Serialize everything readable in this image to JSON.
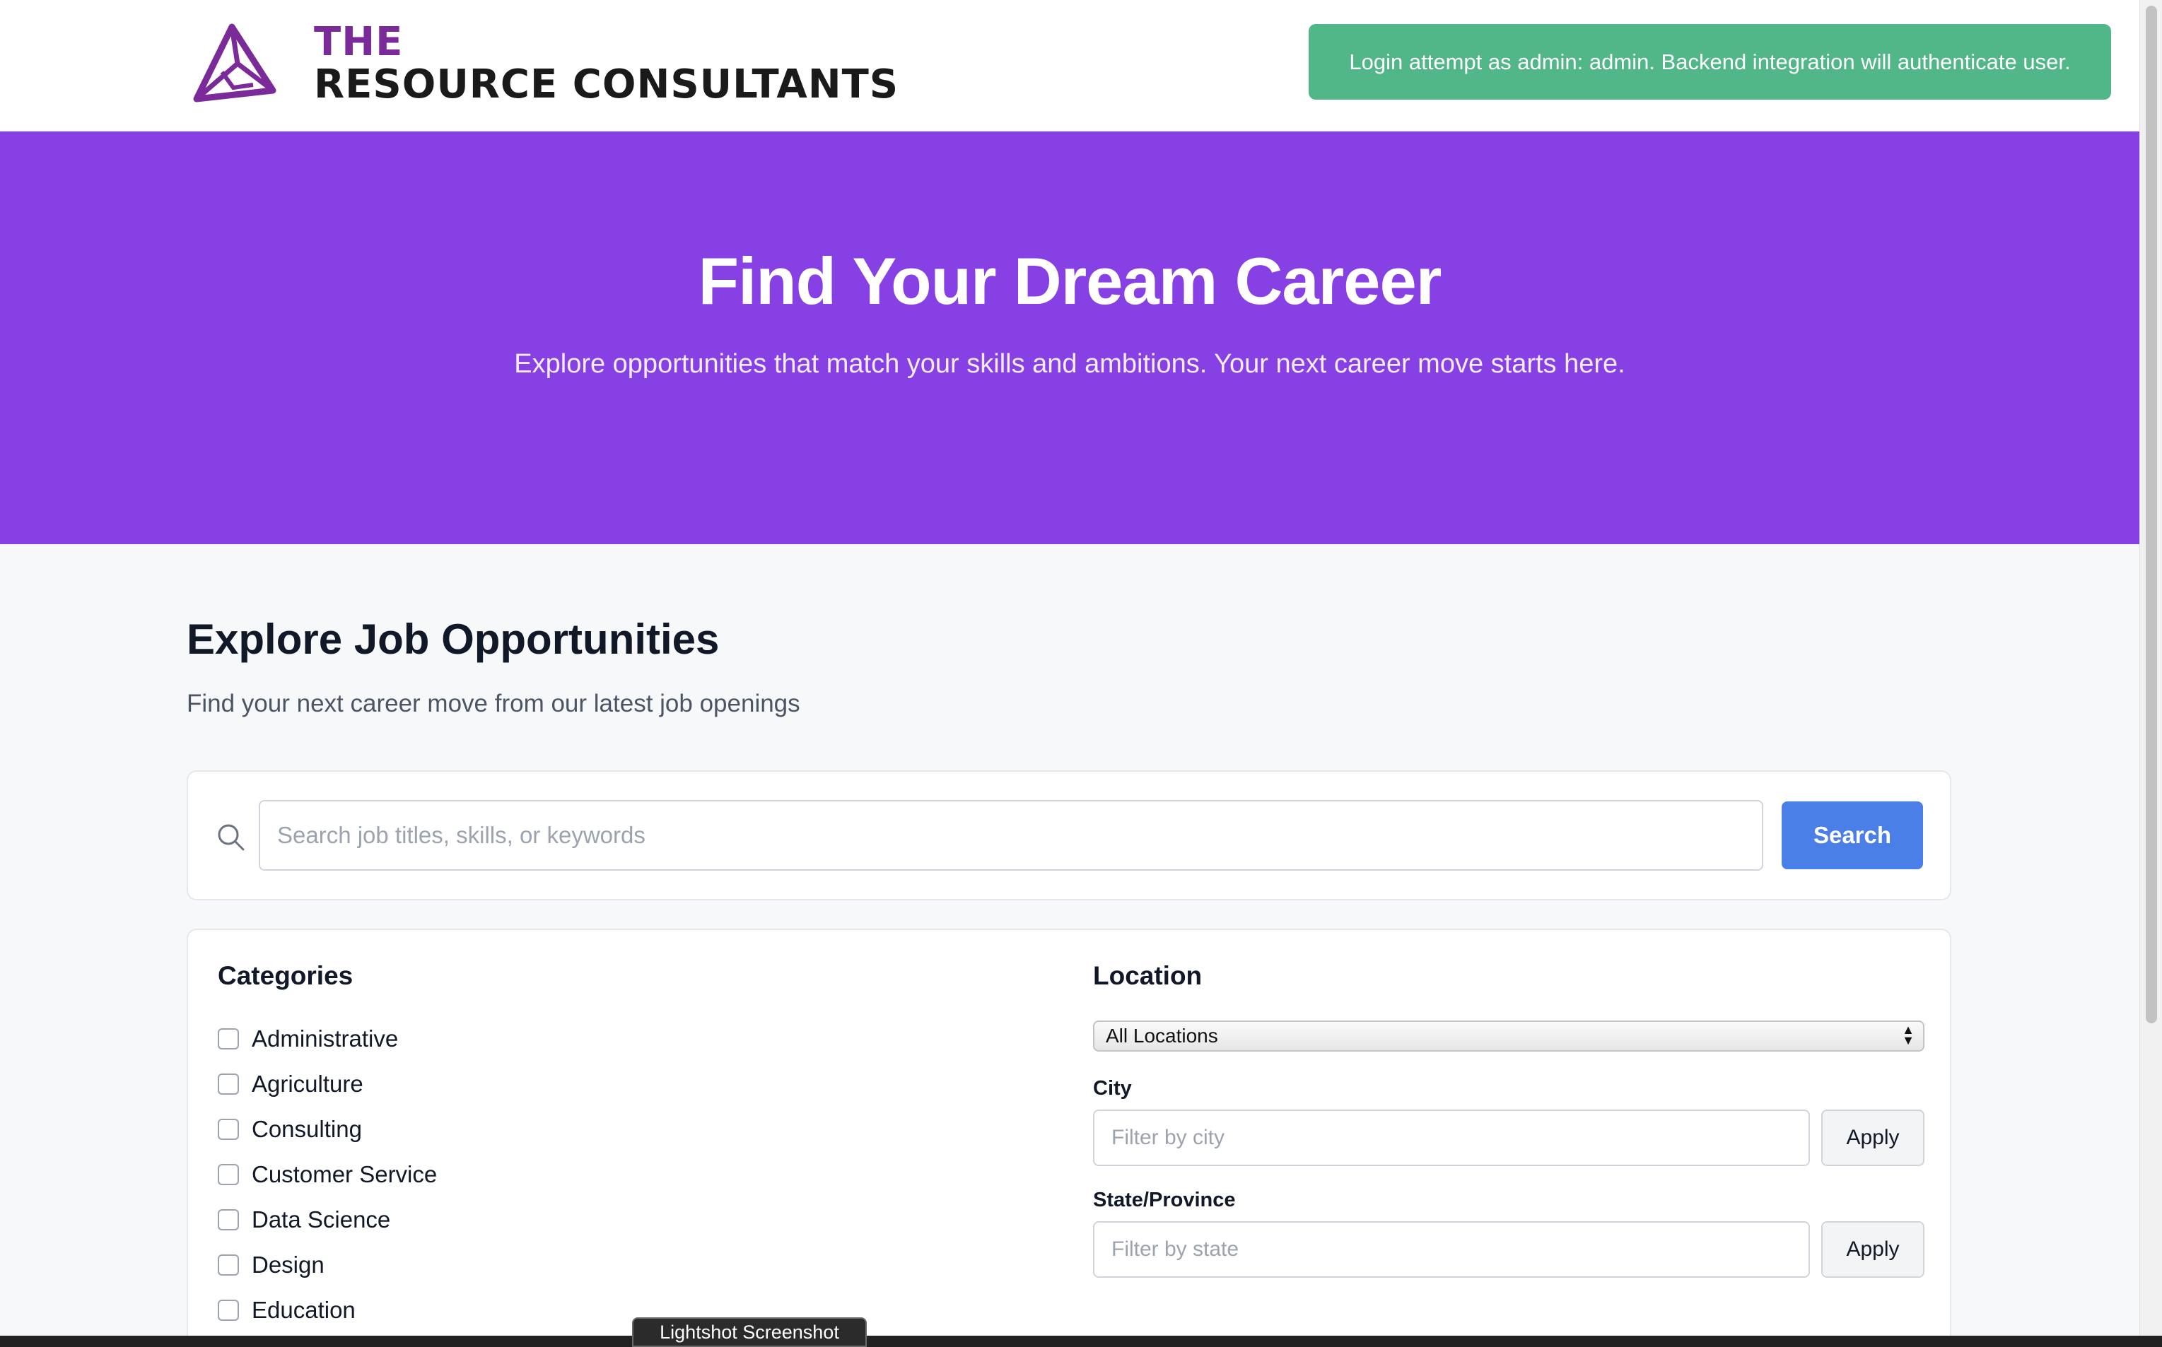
{
  "header": {
    "logo_line1": "THE",
    "logo_line2": "RESOURCE CONSULTANTS",
    "toast_message": "Login attempt as admin: admin. Backend integration will authenticate user."
  },
  "hero": {
    "title": "Find Your Dream Career",
    "subtitle": "Explore opportunities that match your skills and ambitions. Your next career move starts here."
  },
  "jobs": {
    "title": "Explore Job Opportunities",
    "subtitle": "Find your next career move from our latest job openings",
    "search": {
      "placeholder": "Search job titles, skills, or keywords",
      "button_label": "Search",
      "icon": "search-icon"
    }
  },
  "filters": {
    "categories_heading": "Categories",
    "categories": [
      {
        "label": "Administrative",
        "checked": false
      },
      {
        "label": "Agriculture",
        "checked": false
      },
      {
        "label": "Consulting",
        "checked": false
      },
      {
        "label": "Customer Service",
        "checked": false
      },
      {
        "label": "Data Science",
        "checked": false
      },
      {
        "label": "Design",
        "checked": false
      },
      {
        "label": "Education",
        "checked": false
      }
    ],
    "location_heading": "Location",
    "location_selected": "All Locations",
    "city_label": "City",
    "city_placeholder": "Filter by city",
    "city_apply": "Apply",
    "state_label": "State/Province",
    "state_placeholder": "Filter by state",
    "state_apply": "Apply"
  },
  "overlay": {
    "lightshot_label": "Lightshot Screenshot"
  },
  "colors": {
    "hero_bg": "#8740e3",
    "toast_bg": "#52b788",
    "primary_button": "#4a7fe8",
    "logo_purple": "#7b2a9a"
  }
}
